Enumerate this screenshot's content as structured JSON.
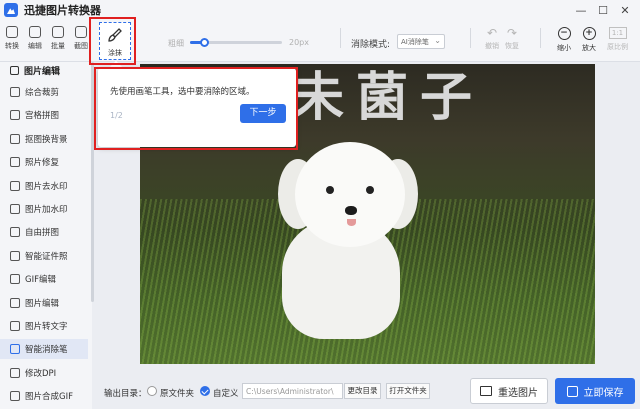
{
  "app": {
    "title": "迅捷图片转换器"
  },
  "window": {
    "min": "—",
    "max": "☐",
    "close": "✕"
  },
  "toolbar": {
    "mini_tools": [
      "转换",
      "编辑",
      "批量",
      "截图"
    ],
    "smear_label": "涂抹",
    "size_label": "粗细",
    "size_max": "20px",
    "size_fraction": 0.15,
    "mode_label": "消除模式:",
    "mode_value": "AI消除笔",
    "undo_label": "撤销",
    "redo_label": "恢复",
    "zoom_out_label": "缩小",
    "zoom_in_label": "放大",
    "ratio_glyph": "1:1",
    "ratio_label": "原比例"
  },
  "sidebar": {
    "header": "图片编辑",
    "items": [
      "综合裁剪",
      "宫格拼图",
      "抠图换背景",
      "照片修复",
      "图片去水印",
      "图片加水印",
      "自由拼图",
      "智能证件照",
      "GIF编辑",
      "图片编辑",
      "图片转文字",
      "智能消除笔",
      "修改DPI",
      "图片合成GIF"
    ],
    "active_index": 11
  },
  "canvas": {
    "watermark_text": "未菌子"
  },
  "tooltip": {
    "message": "先使用画笔工具，选中要消除的区域。",
    "step": "1/2",
    "next_label": "下一步"
  },
  "footer": {
    "output_label": "输出目录：",
    "option_source": "原文件夹",
    "option_custom": "自定义",
    "path_value": "C:\\Users\\Administrator\\",
    "change_dir_label": "更改目录",
    "open_folder_label": "打开文件夹",
    "reselect_label": "重选图片",
    "save_label": "立即保存"
  },
  "colors": {
    "accent": "#2f6fe8",
    "highlight": "#e02020"
  }
}
